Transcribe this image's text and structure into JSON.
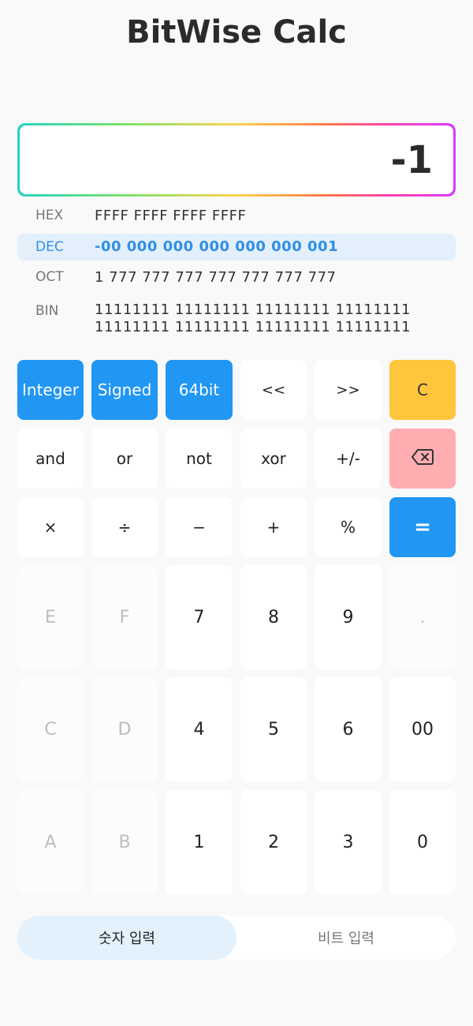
{
  "app": {
    "title": "BitWise Calc"
  },
  "display": {
    "value": "-1"
  },
  "conversions": {
    "hex": {
      "label": "HEX",
      "value": "FFFF FFFF FFFF FFFF"
    },
    "dec": {
      "label": "DEC",
      "value": "-00 000 000 000 000 000 001"
    },
    "oct": {
      "label": "OCT",
      "value": "1 777 777 777 777 777 777 777"
    },
    "bin": {
      "label": "BIN",
      "line1": "11111111 11111111 11111111 11111111",
      "line2": "11111111 11111111 11111111 11111111"
    }
  },
  "keys": {
    "mode_integer": "Integer",
    "mode_signed": "Signed",
    "mode_64bit": "64bit",
    "shift_left": "<<",
    "shift_right": ">>",
    "clear": "C",
    "and": "and",
    "or": "or",
    "not": "not",
    "xor": "xor",
    "negate": "+/-",
    "multiply": "×",
    "divide": "÷",
    "minus": "−",
    "plus": "+",
    "percent": "%",
    "equals": "=",
    "hex_e": "E",
    "hex_f": "F",
    "digit_7": "7",
    "digit_8": "8",
    "digit_9": "9",
    "dot": ".",
    "hex_c": "C",
    "hex_d": "D",
    "digit_4": "4",
    "digit_5": "5",
    "digit_6": "6",
    "double_zero": "00",
    "hex_a": "A",
    "hex_b": "B",
    "digit_1": "1",
    "digit_2": "2",
    "digit_3": "3",
    "digit_0": "0"
  },
  "icons": {
    "backspace": "backspace-icon"
  },
  "colors": {
    "accent_blue": "#2196f3",
    "clear_yellow": "#ffc53d",
    "backspace_red": "#ffadb0"
  },
  "tabs": {
    "number_input": "숫자 입력",
    "bit_input": "비트 입력"
  }
}
